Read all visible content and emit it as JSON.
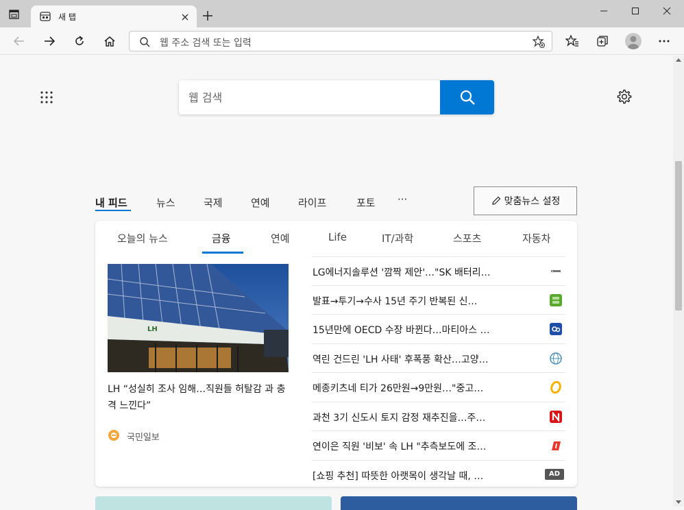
{
  "browser": {
    "tab_title": "새 탭",
    "address_placeholder": "웹 주소 검색 또는 입력"
  },
  "page": {
    "search_placeholder": "웹 검색",
    "feed_tabs": [
      "내 피드",
      "뉴스",
      "국제",
      "연예",
      "라이프",
      "포토",
      "···"
    ],
    "personalize_label": "맞춤뉴스 설정",
    "categories": [
      "오늘의 뉴스",
      "금융",
      "연예",
      "Life",
      "IT/과학",
      "스포츠",
      "자동차"
    ],
    "active_category": "금융",
    "hero": {
      "caption": "LH “성실히 조사 임해…직원들 허탈감 과 충격 느낀다”",
      "source": "국민일보"
    },
    "news": [
      {
        "title": "LG에너지솔루션 '깜짝 제안'…\"SK 배터리…",
        "logo": "publisher-logo-gray",
        "logo_color": "#777777"
      },
      {
        "title": "발표→투기→수사 15년 주기 반복된 신…",
        "logo": "publisher-logo-green",
        "logo_color": "#5aa832"
      },
      {
        "title": "15년만에 OECD 수장 바뀐다…마티아스 …",
        "logo": "publisher-logo-blue",
        "logo_color": "#1e4fa8"
      },
      {
        "title": "역린 건드린 'LH 사태' 후폭풍 확산…고양…",
        "logo": "publisher-logo-globe",
        "logo_color": "#4a8fb8"
      },
      {
        "title": "메종키츠네 티가 26만원→9만원…\"중고…",
        "logo": "publisher-logo-yellow",
        "logo_color": "#f5b000"
      },
      {
        "title": "과천 3기 신도시 토지 감정 재추진을…주…",
        "logo": "publisher-logo-red-n",
        "logo_color": "#d7141a"
      },
      {
        "title": "연이은 직원 '비보' 속 LH \"추측보도에 조…",
        "logo": "publisher-logo-red",
        "logo_color": "#e8382b"
      }
    ],
    "ad": {
      "title": "[쇼핑 추천] 따뜻한 아랫목이 생각날 때, …",
      "badge": "AD"
    }
  }
}
